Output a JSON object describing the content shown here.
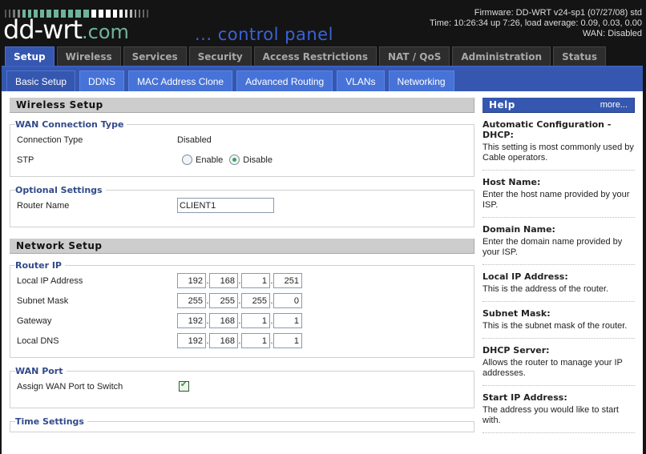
{
  "header": {
    "logo_main": "dd-wrt",
    "logo_suffix": ".com",
    "tagline": "... control panel",
    "firmware": "Firmware: DD-WRT v24-sp1 (07/27/08) std",
    "time": "Time: 10:26:34 up 7:26, load average: 0.09, 0.03, 0.00",
    "wan": "WAN: Disabled"
  },
  "main_tabs": [
    {
      "label": "Setup",
      "active": true
    },
    {
      "label": "Wireless",
      "active": false
    },
    {
      "label": "Services",
      "active": false
    },
    {
      "label": "Security",
      "active": false
    },
    {
      "label": "Access Restrictions",
      "active": false
    },
    {
      "label": "NAT / QoS",
      "active": false
    },
    {
      "label": "Administration",
      "active": false
    },
    {
      "label": "Status",
      "active": false
    }
  ],
  "sub_tabs": [
    {
      "label": "Basic Setup",
      "active": true
    },
    {
      "label": "DDNS",
      "active": false
    },
    {
      "label": "MAC Address Clone",
      "active": false
    },
    {
      "label": "Advanced Routing",
      "active": false
    },
    {
      "label": "VLANs",
      "active": false
    },
    {
      "label": "Networking",
      "active": false
    }
  ],
  "wireless_setup": {
    "title": "Wireless Setup",
    "wan_connection": {
      "legend": "WAN Connection Type",
      "connection_type_label": "Connection Type",
      "connection_type_value": "Disabled",
      "stp_label": "STP",
      "stp_options": [
        "Enable",
        "Disable"
      ],
      "stp_selected": "Disable"
    },
    "optional": {
      "legend": "Optional Settings",
      "router_name_label": "Router Name",
      "router_name_value": "CLIENT1"
    }
  },
  "network_setup": {
    "title": "Network Setup",
    "router_ip": {
      "legend": "Router IP",
      "rows": [
        {
          "label": "Local IP Address",
          "octets": [
            "192",
            "168",
            "1",
            "251"
          ]
        },
        {
          "label": "Subnet Mask",
          "octets": [
            "255",
            "255",
            "255",
            "0"
          ]
        },
        {
          "label": "Gateway",
          "octets": [
            "192",
            "168",
            "1",
            "1"
          ]
        },
        {
          "label": "Local DNS",
          "octets": [
            "192",
            "168",
            "1",
            "1"
          ]
        }
      ]
    },
    "wan_port": {
      "legend": "WAN Port",
      "assign_label": "Assign WAN Port to Switch",
      "assign_checked": true
    },
    "time_settings": {
      "legend": "Time Settings"
    }
  },
  "help": {
    "title": "Help",
    "more": "more...",
    "items": [
      {
        "title": "Automatic Configuration - DHCP:",
        "text": "This setting is most commonly used by Cable operators."
      },
      {
        "title": "Host Name:",
        "text": "Enter the host name provided by your ISP."
      },
      {
        "title": "Domain Name:",
        "text": "Enter the domain name provided by your ISP."
      },
      {
        "title": "Local IP Address:",
        "text": "This is the address of the router."
      },
      {
        "title": "Subnet Mask:",
        "text": "This is the subnet mask of the router."
      },
      {
        "title": "DHCP Server:",
        "text": "Allows the router to manage your IP addresses."
      },
      {
        "title": "Start IP Address:",
        "text": "The address you would like to start with."
      }
    ]
  },
  "colors": {
    "accent_blue": "#3557b0",
    "subtab_blue": "#4773d8",
    "logo_green": "#6fb39a",
    "tagline_blue": "#3a63d8"
  }
}
